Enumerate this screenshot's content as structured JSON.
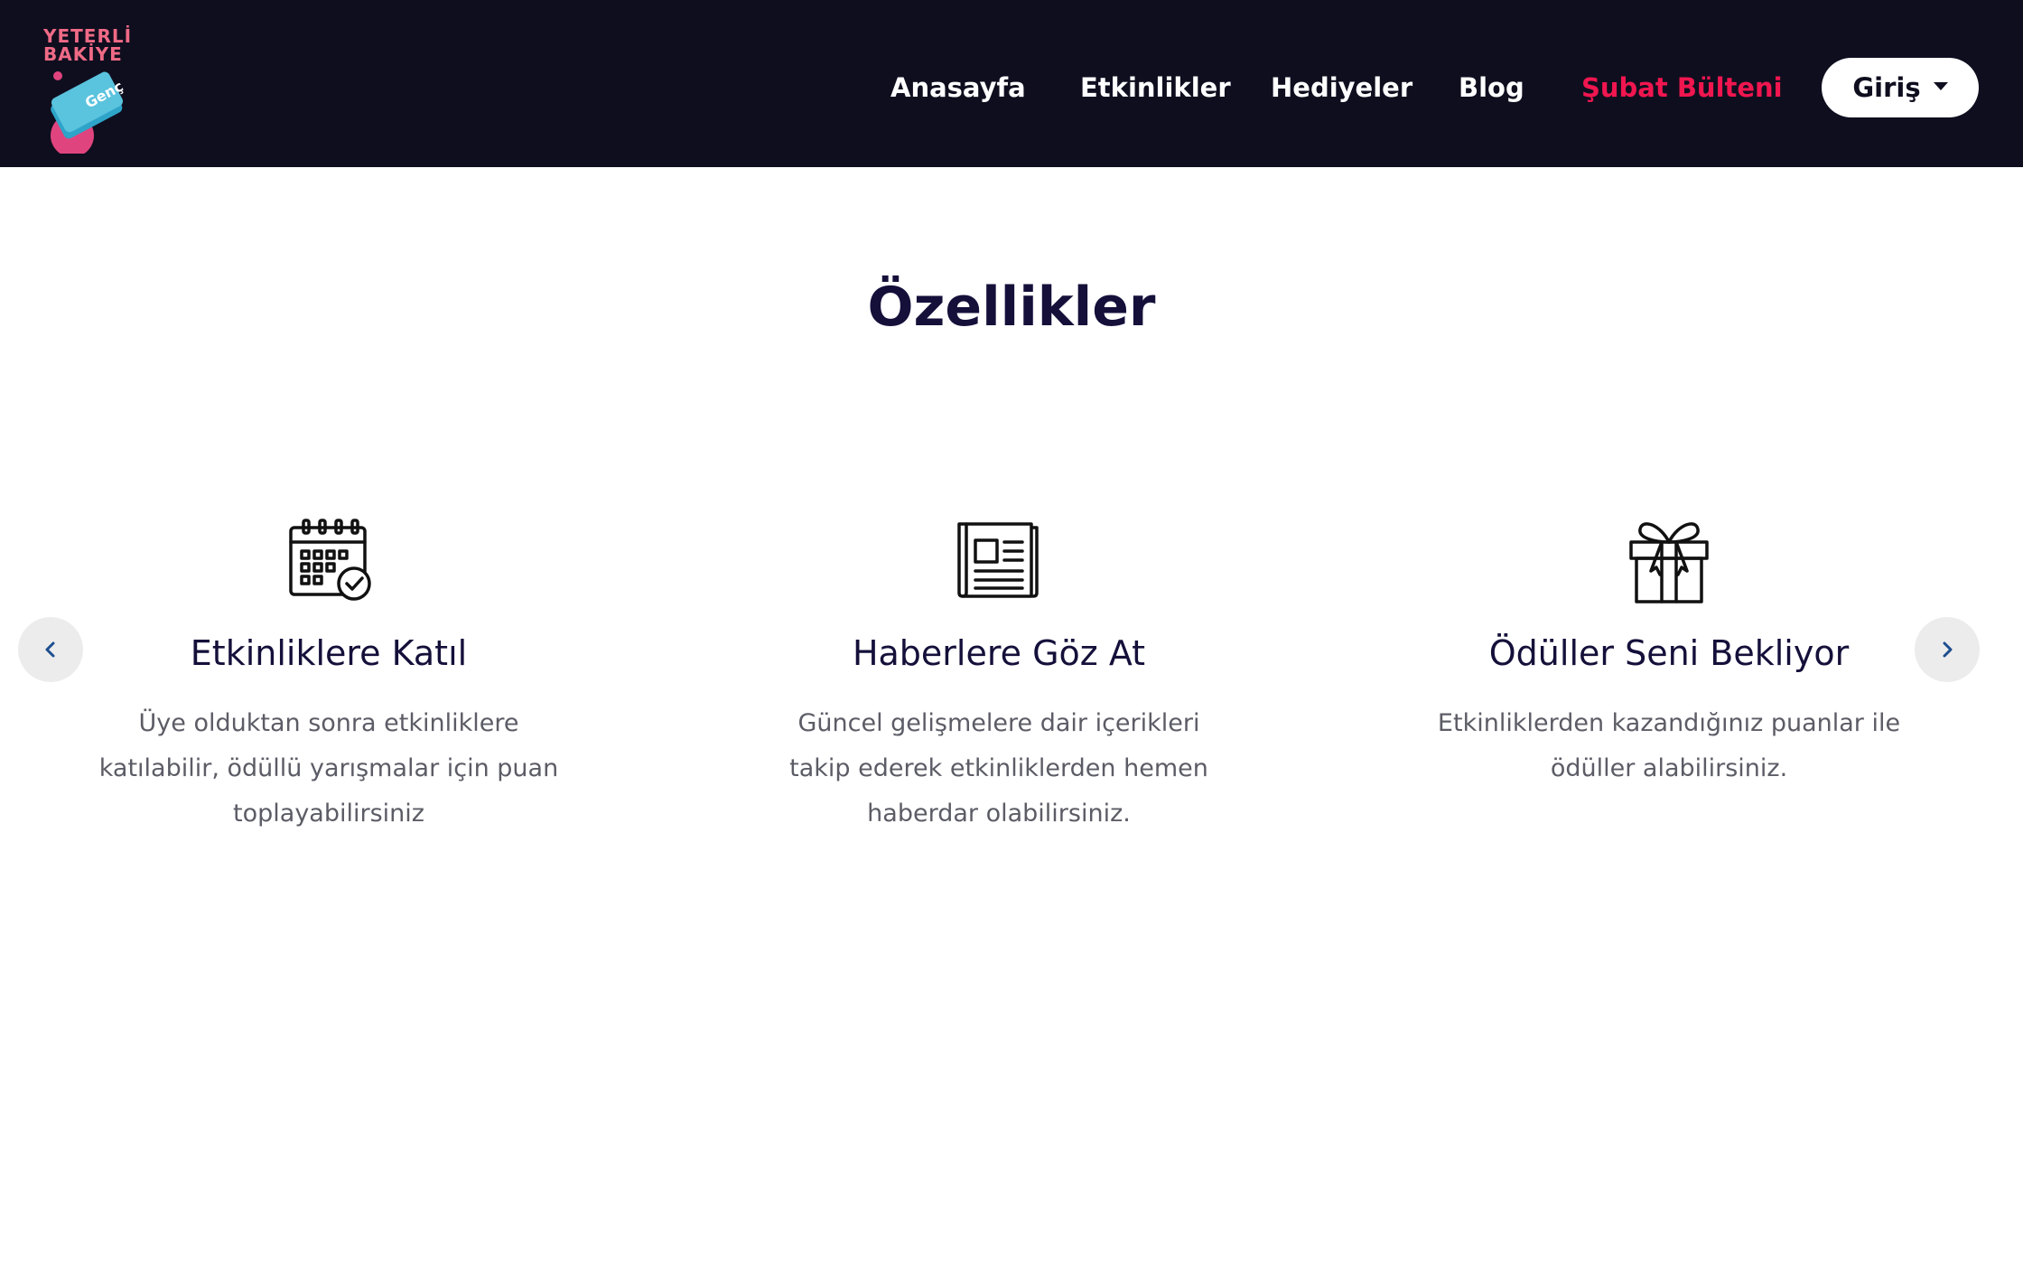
{
  "header": {
    "logo": {
      "line1": "YETERLİ",
      "line2": "BAKİYE",
      "card_text": "Genç"
    },
    "nav": [
      {
        "label": "Anasayfa"
      },
      {
        "label": "Etkinlikler"
      },
      {
        "label": "Hediyeler"
      },
      {
        "label": "Blog"
      },
      {
        "label": "Şubat Bülteni"
      }
    ],
    "login_label": "Giriş",
    "colors": {
      "background": "#0f0e1f",
      "highlight": "#f0164f"
    }
  },
  "main": {
    "title": "Özellikler",
    "features": [
      {
        "icon": "calendar-check-icon",
        "title": "Etkinliklere Katıl",
        "description": "Üye olduktan sonra etkinliklere katılabilir, ödüllü yarışmalar için puan toplayabilirsiniz"
      },
      {
        "icon": "newspaper-icon",
        "title": "Haberlere Göz At",
        "description": "Güncel gelişmelere dair içerikleri takip ederek etkinliklerden hemen haberdar olabilirsiniz."
      },
      {
        "icon": "gift-icon",
        "title": "Ödüller Seni Bekliyor",
        "description": "Etkinliklerden kazandığınız puanlar ile ödüller alabilirsiniz."
      }
    ],
    "slider": {
      "prev_icon": "chevron-left-icon",
      "next_icon": "chevron-right-icon"
    }
  }
}
